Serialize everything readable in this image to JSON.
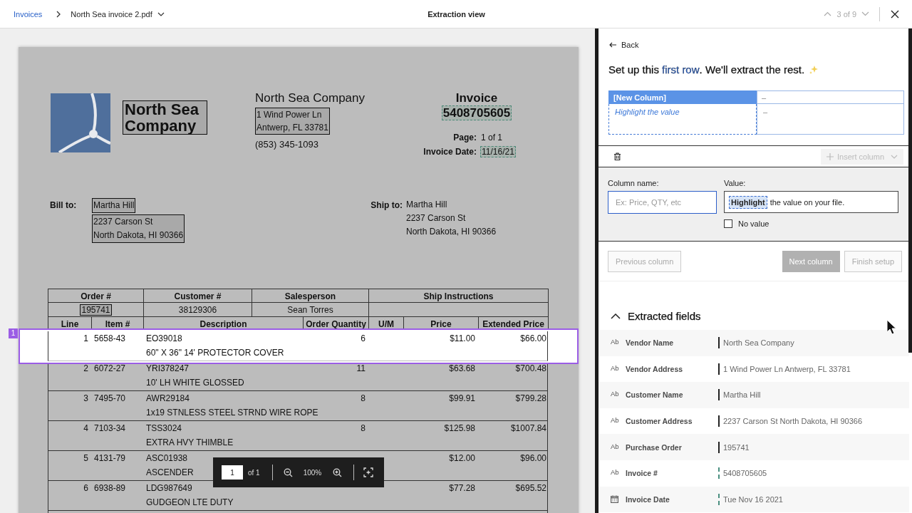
{
  "top_bar": {
    "breadcrumb": "Invoices",
    "file_name": "North Sea invoice 2.pdf",
    "title": "Extraction view",
    "position": "3 of 9"
  },
  "document": {
    "company_name": {
      "text": "North Sea Company",
      "extracted": true,
      "suggested": false
    },
    "vendor": {
      "name": "North Sea Company",
      "address": {
        "lines": [
          "1 Wind Power Ln",
          "Antwerp, FL 33781"
        ],
        "extracted": true,
        "suggested": false
      },
      "phone": "(853) 345-1093"
    },
    "invoice": {
      "title": "Invoice",
      "number": {
        "text": "5408705605",
        "extracted": true,
        "suggested": true
      },
      "fields": [
        {
          "label": "Page:",
          "value": "1 of 1",
          "extracted": false,
          "suggested": false
        },
        {
          "label": "Invoice Date:",
          "value": "11/16/21",
          "extracted": true,
          "suggested": true
        }
      ]
    },
    "bill_to": {
      "label": "Bill to:",
      "groups": [
        {
          "lines": [
            "Martha Hill"
          ],
          "extracted": true,
          "suggested": false
        },
        {
          "lines": [
            "2237 Carson St",
            "North Dakota, HI 90366"
          ],
          "extracted": true,
          "suggested": false
        }
      ]
    },
    "ship_to": {
      "label": "Ship to:",
      "groups": [
        {
          "lines": [
            "Martha Hill",
            "2237 Carson St",
            "North Dakota, HI 90366"
          ],
          "extracted": false,
          "suggested": false
        }
      ]
    },
    "order_table": {
      "columns": [
        "Order #",
        "Customer #",
        "Salesperson",
        "Ship Instructions"
      ],
      "values": [
        {
          "text": "195741",
          "extracted": true,
          "suggested": false
        },
        {
          "text": "38129306",
          "extracted": false,
          "suggested": false
        },
        {
          "text": "Sean Torres",
          "extracted": false,
          "suggested": false
        }
      ]
    },
    "line_items": {
      "columns": [
        "Line",
        "Item #",
        "Description",
        "Order Quantity",
        "U/M",
        "Price",
        "Extended Price"
      ],
      "selection_badge": "1",
      "rows": [
        {
          "line": "1",
          "item": "5658-43",
          "code": "EO39018",
          "description": "60\" X 36\" 14' PROTECTOR COVER",
          "quantity": "6",
          "price": "$11.00",
          "extended": "$66.00",
          "selected": true
        },
        {
          "line": "2",
          "item": "6072-27",
          "code": "YRI378247",
          "description": "10' LH WHITE GLOSSED",
          "quantity": "11",
          "price": "$63.68",
          "extended": "$700.48",
          "selected": false
        },
        {
          "line": "3",
          "item": "7495-70",
          "code": "AWR29184",
          "description": "1x19 STNLESS STEEL STRND WIRE ROPE",
          "quantity": "8",
          "price": "$99.91",
          "extended": "$799.28",
          "selected": false
        },
        {
          "line": "4",
          "item": "7103-34",
          "code": "TSS3024",
          "description": "EXTRA HVY THIMBLE",
          "quantity": "8",
          "price": "$125.98",
          "extended": "$1007.84",
          "selected": false
        },
        {
          "line": "5",
          "item": "4131-79",
          "code": "ASC01938",
          "description": "ASCENDER",
          "price": "$12.00",
          "extended": "$96.00",
          "selected": false
        },
        {
          "line": "6",
          "item": "6938-89",
          "code": "LDG987649",
          "description": "GUDGEON LTE DUTY",
          "price": "$77.28",
          "extended": "$695.52",
          "selected": false
        }
      ]
    }
  },
  "pdf_toolbar": {
    "page": "1",
    "page_count": "of 1",
    "zoom": "100%"
  },
  "panel": {
    "back": "Back",
    "heading": [
      {
        "text": "Set up this ",
        "kind": "plain"
      },
      {
        "text": "first row",
        "kind": "accent"
      },
      {
        "text": ". We'll extract the rest.",
        "kind": "plain"
      }
    ],
    "preview": [
      {
        "header": "[New Column]",
        "value_placeholder": "Highlight the value",
        "selected": true
      },
      {
        "header": "–",
        "value": "–",
        "selected": false
      }
    ],
    "insert_column": {
      "label": "Insert column",
      "disabled": true
    },
    "form": {
      "column_name_label": "Column name:",
      "column_name_placeholder": "Ex: Price, QTY, etc",
      "value_label": "Value:",
      "value_chip": "Highlight",
      "value_hint": "the value on your file.",
      "no_value": {
        "label": "No value",
        "checked": false
      }
    },
    "buttons": [
      {
        "label": "Previous column",
        "kind": "secondary",
        "disabled": true
      },
      {
        "label": "Next column",
        "kind": "primary",
        "disabled": true
      },
      {
        "label": "Finish setup",
        "kind": "secondary",
        "disabled": true
      }
    ],
    "extracted": {
      "title": "Extracted fields",
      "expanded": true,
      "fields": [
        {
          "kind": "text",
          "type_label": "Ab",
          "label": "Vendor Name",
          "value": "North Sea Company",
          "suggested": false
        },
        {
          "kind": "text",
          "type_label": "Ab",
          "label": "Vendor Address",
          "value": "1 Wind Power Ln Antwerp, FL 33781",
          "suggested": false
        },
        {
          "kind": "text",
          "type_label": "Ab",
          "label": "Customer Name",
          "value": "Martha Hill",
          "suggested": false
        },
        {
          "kind": "text",
          "type_label": "Ab",
          "label": "Customer Address",
          "value": "2237 Carson St North Dakota, HI 90366",
          "suggested": false
        },
        {
          "kind": "text",
          "type_label": "Ab",
          "label": "Purchase Order",
          "value": "195741",
          "suggested": false
        },
        {
          "kind": "text",
          "type_label": "Ab",
          "label": "Invoice #",
          "value": "5408705605",
          "suggested": true
        },
        {
          "kind": "date",
          "label": "Invoice Date",
          "value": "Tue Nov 16 2021",
          "suggested": true
        }
      ]
    }
  }
}
